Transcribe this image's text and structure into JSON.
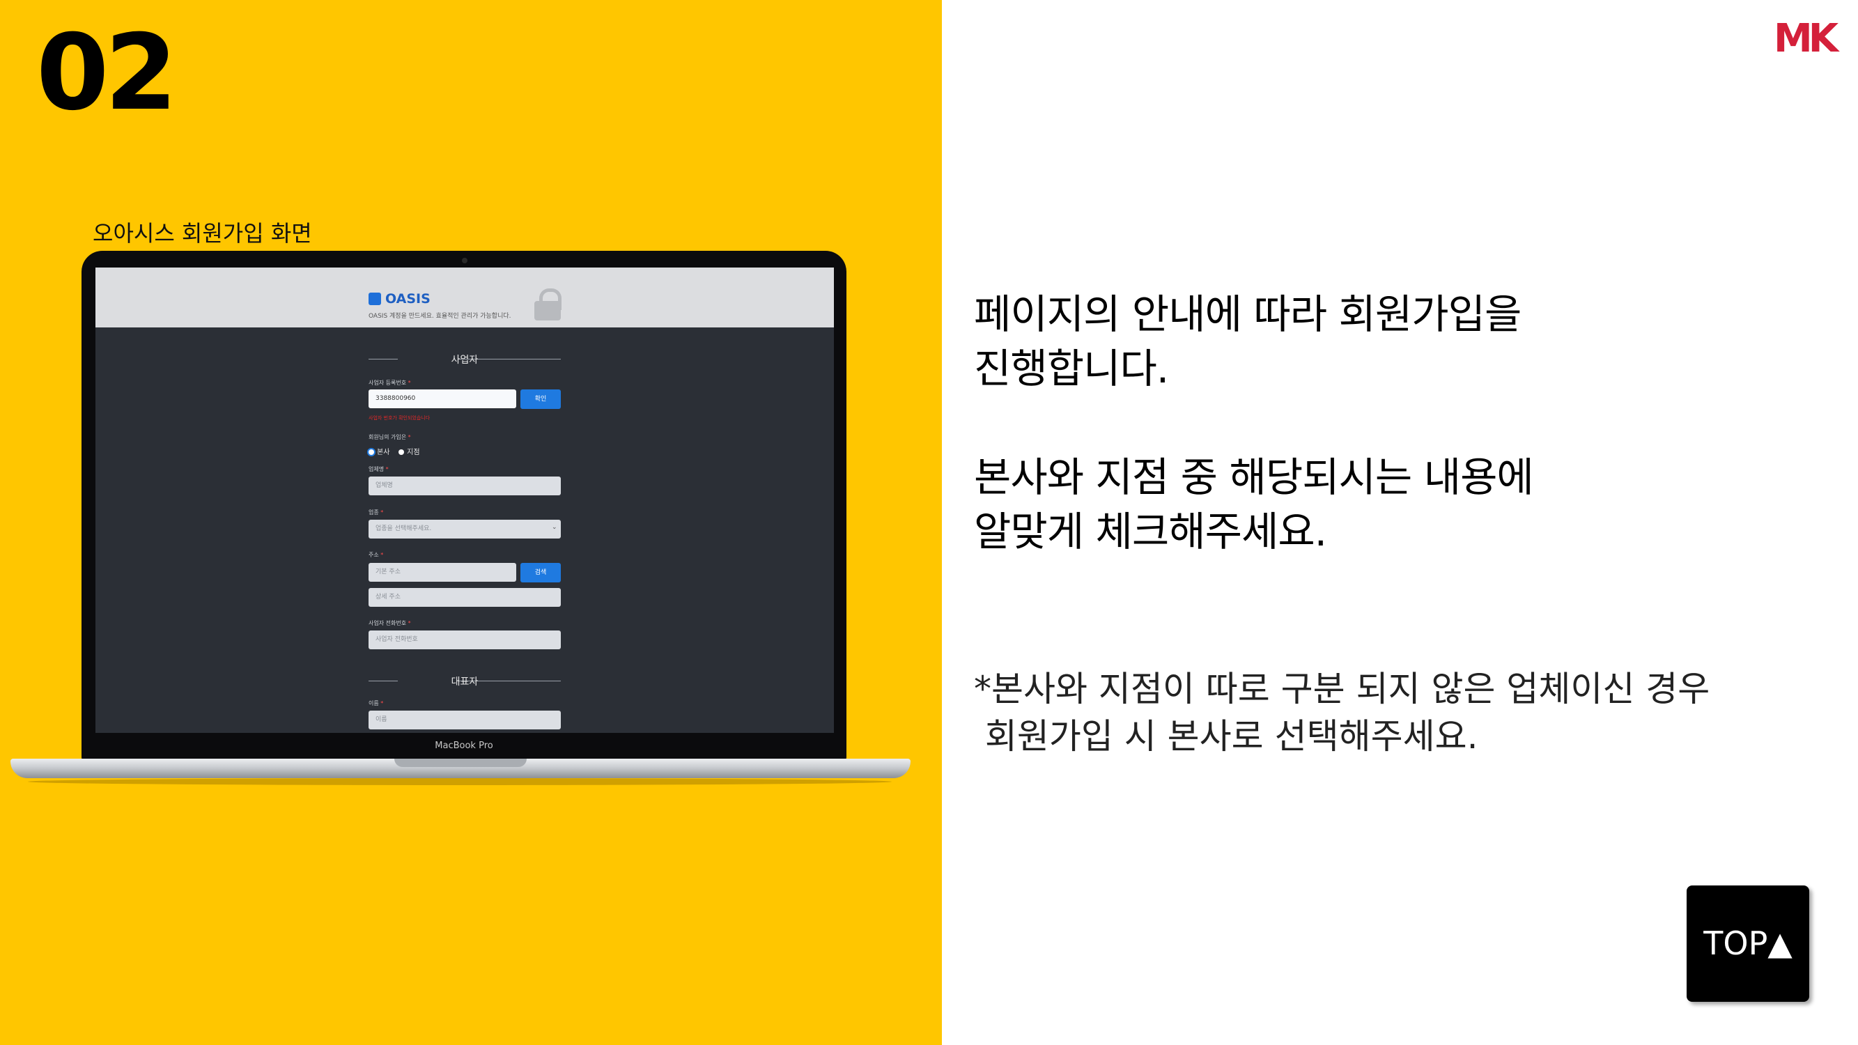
{
  "slide": {
    "step_number": "02",
    "screenshot_caption": "오아시스 회원가입 화면",
    "laptop_model": "MacBook Pro",
    "headline_lines": [
      "페이지의 안내에 따라 회원가입을",
      "진행합니다.",
      "본사와 지점 중 해당되시는 내용에",
      "알맞게 체크해주세요."
    ],
    "note_lines": [
      "*본사와 지점이 따로 구분 되지 않은 업체이신 경우",
      " 회원가입 시 본사로 선택해주세요."
    ],
    "brand_logo_text": "MK",
    "top_button_label": "TOP▲",
    "colors": {
      "left_panel": "#ffc600",
      "right_panel": "#ffffff",
      "brand": "#d4203a"
    }
  },
  "signup_form": {
    "logo_text": "OASIS",
    "subtitle": "OASIS 계정을 만드세요. 효율적인 관리가 가능합니다.",
    "business_section_title": "사업자",
    "business_reg_label": "사업자 등록번호",
    "business_reg_value": "3388800960",
    "confirm_button": "확인",
    "business_reg_error": "사업자 번호가 확인되었습니다",
    "branch_type_label": "회원님의 가입은",
    "radio_head_office": "본사",
    "radio_branch": "지점",
    "company_name_label": "업체명",
    "company_name_placeholder": "업체명",
    "industry_label": "업종",
    "industry_placeholder": "업종을 선택해주세요.",
    "address_label": "주소",
    "address_placeholder": "기본 주소",
    "search_button": "검색",
    "address_detail_placeholder": "상세 주소",
    "phone_label": "사업자 전화번호",
    "phone_placeholder": "사업자 전화번호",
    "rep_section_title": "대표자",
    "rep_name_label": "이름",
    "rep_name_placeholder": "이름",
    "required_mark": "*"
  }
}
